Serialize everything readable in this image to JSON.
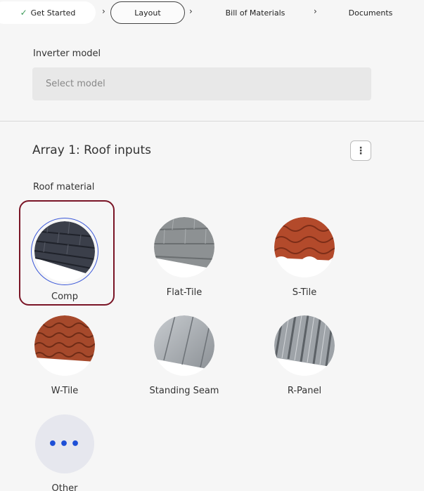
{
  "stepper": {
    "steps": [
      {
        "label": "Get Started",
        "state": "done"
      },
      {
        "label": "Layout",
        "state": "active"
      },
      {
        "label": "Bill of Materials",
        "state": "pending"
      },
      {
        "label": "Documents",
        "state": "pending"
      }
    ],
    "check_glyph": "✓",
    "separator_glyph": "›"
  },
  "inverter": {
    "label": "Inverter model",
    "placeholder": "Select model"
  },
  "array": {
    "title": "Array 1: Roof inputs",
    "menu_glyph": "⋮",
    "roof_material_label": "Roof material",
    "materials": [
      {
        "label": "Comp",
        "icon": "comp-shingle-icon",
        "selected": true
      },
      {
        "label": "Flat-Tile",
        "icon": "flat-tile-icon",
        "selected": false
      },
      {
        "label": "S-Tile",
        "icon": "s-tile-icon",
        "selected": false
      },
      {
        "label": "W-Tile",
        "icon": "w-tile-icon",
        "selected": false
      },
      {
        "label": "Standing Seam",
        "icon": "standing-seam-icon",
        "selected": false
      },
      {
        "label": "R-Panel",
        "icon": "r-panel-icon",
        "selected": false
      },
      {
        "label": "Other",
        "icon": "more-dots-icon",
        "selected": false
      }
    ],
    "other_glyph": "•••"
  },
  "colors": {
    "selected_frame": "#7a1526",
    "selected_ring": "#3a57d8",
    "done_check": "#3c9a58",
    "other_dots": "#1d4fd6"
  }
}
